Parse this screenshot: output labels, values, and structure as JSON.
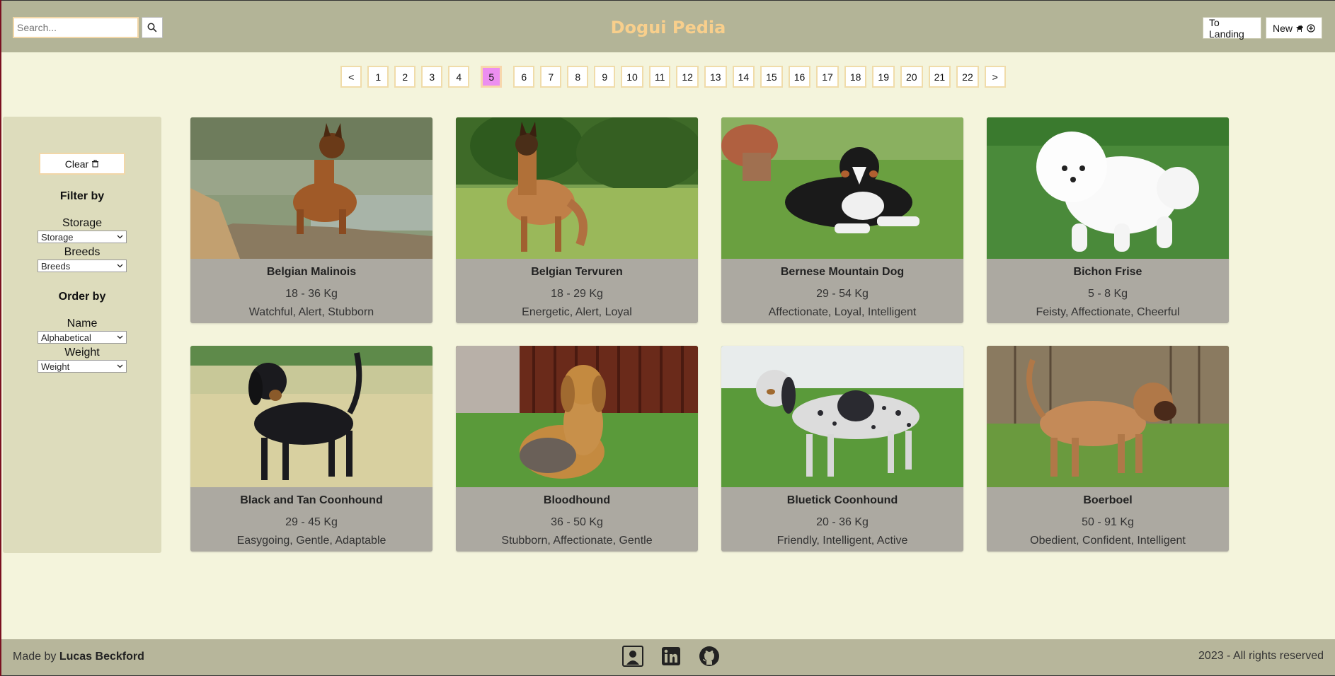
{
  "header": {
    "title": "Dogui Pedia",
    "search_placeholder": "Search...",
    "landing_label": "To Landing",
    "new_label": "New"
  },
  "pagination": {
    "prev": "<",
    "next": ">",
    "pages": [
      "1",
      "2",
      "3",
      "4",
      "5",
      "6",
      "7",
      "8",
      "9",
      "10",
      "11",
      "12",
      "13",
      "14",
      "15",
      "16",
      "17",
      "18",
      "19",
      "20",
      "21",
      "22"
    ],
    "current": "5"
  },
  "sidebar": {
    "clear_label": "Clear",
    "filter_heading": "Filter by",
    "storage_label": "Storage",
    "storage_value": "Storage",
    "breeds_label": "Breeds",
    "breeds_value": "Breeds",
    "order_heading": "Order by",
    "name_label": "Name",
    "name_value": "Alphabetical",
    "weight_label": "Weight",
    "weight_value": "Weight"
  },
  "cards": [
    {
      "name": "Belgian Malinois",
      "weight": "18 - 36 Kg",
      "temperament": "Watchful, Alert, Stubborn"
    },
    {
      "name": "Belgian Tervuren",
      "weight": "18 - 29 Kg",
      "temperament": "Energetic, Alert, Loyal"
    },
    {
      "name": "Bernese Mountain Dog",
      "weight": "29 - 54 Kg",
      "temperament": "Affectionate, Loyal, Intelligent"
    },
    {
      "name": "Bichon Frise",
      "weight": "5 - 8 Kg",
      "temperament": "Feisty, Affectionate, Cheerful"
    },
    {
      "name": "Black and Tan Coonhound",
      "weight": "29 - 45 Kg",
      "temperament": "Easygoing, Gentle, Adaptable"
    },
    {
      "name": "Bloodhound",
      "weight": "36 - 50 Kg",
      "temperament": "Stubborn, Affectionate, Gentle"
    },
    {
      "name": "Bluetick Coonhound",
      "weight": "20 - 36 Kg",
      "temperament": "Friendly, Intelligent, Active"
    },
    {
      "name": "Boerboel",
      "weight": "50 - 91 Kg",
      "temperament": "Obedient, Confident, Intelligent"
    }
  ],
  "footer": {
    "made_by_prefix": "Made by",
    "author": "Lucas Beckford",
    "copyright": "2023 - All rights reserved",
    "icons": [
      "portfolio-icon",
      "linkedin-icon",
      "github-icon"
    ]
  },
  "colors": {
    "header_bg": "#b3b497",
    "title": "#f8cf8c",
    "page_bg": "#f4f4dc",
    "sidebar_bg": "#dddcbc",
    "card_bg": "#aca9a1",
    "active_page": "#ec8ef0"
  }
}
